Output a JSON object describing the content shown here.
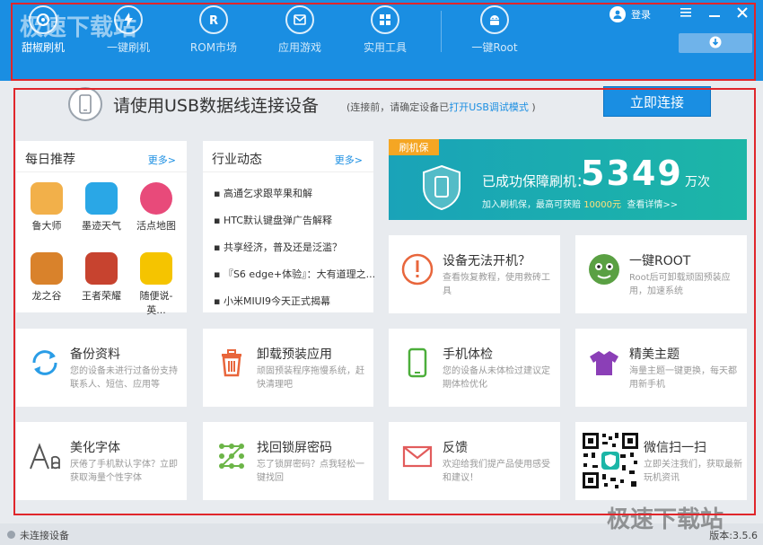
{
  "nav": {
    "items": [
      {
        "label": "甜椒刷机",
        "icon": "home-icon"
      },
      {
        "label": "一键刷机",
        "icon": "flash-icon"
      },
      {
        "label": "ROM市场",
        "icon": "rom-icon"
      },
      {
        "label": "应用游戏",
        "icon": "apps-icon"
      },
      {
        "label": "实用工具",
        "icon": "tools-icon"
      },
      {
        "label": "一键Root",
        "icon": "android-icon"
      }
    ],
    "login": "登录"
  },
  "connect": {
    "title": "请使用USB数据线连接设备",
    "hint_before": "(连接前，请确定设备已",
    "hint_link": "打开USB调试模式",
    "hint_after": ")",
    "button": "立即连接"
  },
  "daily": {
    "title": "每日推荐",
    "more": "更多>",
    "apps": [
      {
        "label": "鲁大师",
        "color": "#f2b04a"
      },
      {
        "label": "墨迹天气",
        "color": "#2aa7e6"
      },
      {
        "label": "活点地图",
        "color": "#e84a7a"
      },
      {
        "label": "龙之谷",
        "color": "#d9822b"
      },
      {
        "label": "王者荣耀",
        "color": "#c7432f"
      },
      {
        "label": "随便说-英...",
        "color": "#f5c400"
      }
    ]
  },
  "news": {
    "title": "行业动态",
    "more": "更多>",
    "items": [
      "▪ 高通乞求跟苹果和解",
      "▪ HTC默认键盘弹广告解释",
      "▪ 共享经济，普及还是泛滥？",
      "▪ 『S6 edge+体验』：大有道理之...",
      "▪ 小米MIUI9今天正式揭幕"
    ]
  },
  "banner": {
    "tag": "刷机保",
    "line1": "已成功保障刷机：",
    "count": "5349",
    "unit": "万次",
    "line2_before": "加入刷机保，最高可获赔",
    "line2_amount": "10000元",
    "line2_link": "查看详情>>"
  },
  "tiles": [
    {
      "title": "设备无法开机？",
      "desc": "查看恢复教程，使用救砖工具"
    },
    {
      "title": "一键ROOT",
      "desc": "Root后可卸载顽固预装应用，加速系统"
    },
    {
      "title": "备份资料",
      "desc": "您的设备未进行过备份支持联系人、短信、应用等"
    },
    {
      "title": "卸载预装应用",
      "desc": "顽固预装程序拖慢系统，赶快清理吧"
    },
    {
      "title": "手机体检",
      "desc": "您的设备从未体检过建议定期体检优化"
    },
    {
      "title": "精美主题",
      "desc": "海量主题一键更换，每天都用新手机"
    },
    {
      "title": "美化字体",
      "desc": "厌倦了手机默认字体？立即获取海量个性字体"
    },
    {
      "title": "找回锁屏密码",
      "desc": "忘了锁屏密码？点我轻松一键找回"
    },
    {
      "title": "反馈",
      "desc": "欢迎给我们提产品使用感受和建议！"
    },
    {
      "title": "微信扫一扫",
      "desc": "立即关注我们，获取最新玩机资讯"
    }
  ],
  "status": {
    "text": "未连接设备",
    "version": "版本:3.5.6"
  },
  "watermark": "极速下载站",
  "colors": {
    "primary": "#1a8ee2",
    "highlight": "#e0262b",
    "banner": "#1cb6a7"
  }
}
